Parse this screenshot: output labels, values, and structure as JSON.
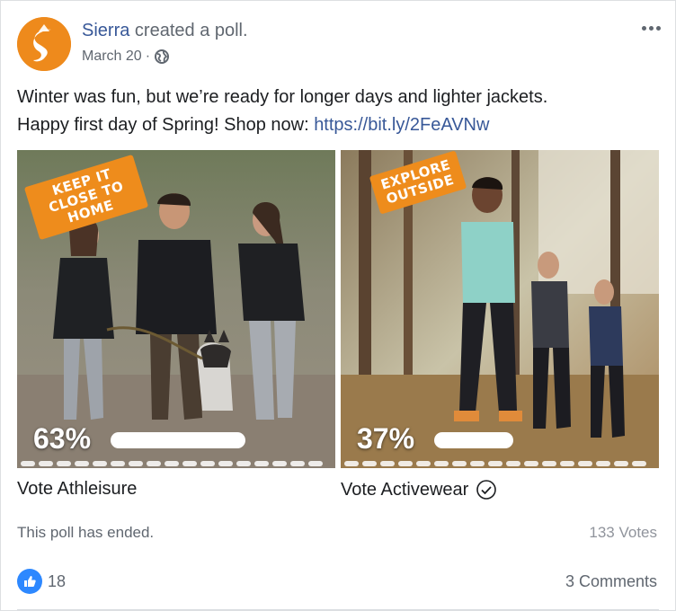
{
  "post": {
    "author": "Sierra",
    "action": "created a poll.",
    "date": "March 20",
    "dot_separator": "·",
    "text_line1": "Winter was fun, but we’re ready for longer days and lighter jackets.",
    "text_line2_prefix": "Happy first day of Spring! Shop now: ",
    "link_text": "https://bit.ly/2FeAVNw",
    "more_icon": "ellipsis-icon",
    "privacy_icon": "globe-icon"
  },
  "poll": {
    "options": [
      {
        "tag": "KEEP IT CLOSE TO HOME",
        "percent_label": "63%",
        "percent_value": 0.63,
        "label": "Vote Athleisure",
        "selected": false
      },
      {
        "tag": "EXPLORE OUTSIDE",
        "percent_label": "37%",
        "percent_value": 0.37,
        "label": "Vote Activewear",
        "selected": true
      }
    ],
    "status": "This poll has ended.",
    "total_votes": "133 Votes"
  },
  "footer": {
    "like_count": "18",
    "comments": "3 Comments",
    "like_icon": "thumbs-up-icon"
  },
  "colors": {
    "brand_orange": "#ee8c1c",
    "link_blue": "#385898",
    "like_blue": "#2d88ff",
    "muted_text": "#606770"
  }
}
